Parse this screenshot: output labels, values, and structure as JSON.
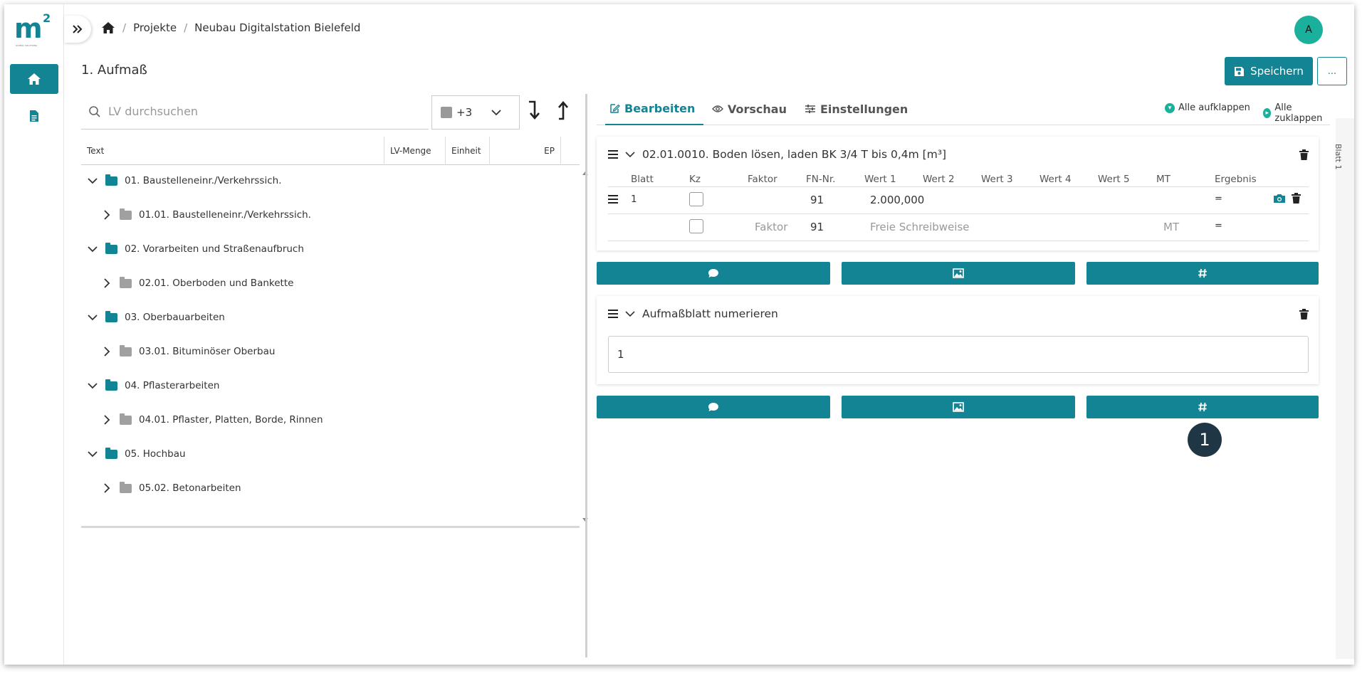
{
  "app": {
    "logo_text": "m",
    "logo_sup": "2",
    "logo_tagline": "GLOBAL SOLUTIONS"
  },
  "sidebar": {
    "items": [
      {
        "icon": "home-icon",
        "active": true
      },
      {
        "icon": "document-icon",
        "active": false
      }
    ]
  },
  "breadcrumb": {
    "home_icon": "home-icon",
    "items": [
      "Projekte",
      "Neubau Digitalstation Bielefeld"
    ],
    "separator": "/"
  },
  "user": {
    "avatar_initial": "A"
  },
  "page": {
    "title": "1. Aufmaß"
  },
  "toolbar": {
    "save_label": "Speichern",
    "more_label": "..."
  },
  "lv_panel": {
    "search_placeholder": "LV durchsuchen",
    "filter_count": "+3",
    "columns": [
      "Text",
      "LV-Menge",
      "Einheit",
      "EP"
    ],
    "tree": [
      {
        "level": 0,
        "label": "01. Baustelleneinr./Verkehrssich.",
        "expanded": true
      },
      {
        "level": 1,
        "label": "01.01. Baustelleneinr./Verkehrssich.",
        "expanded": false
      },
      {
        "level": 0,
        "label": "02. Vorarbeiten und Straßenaufbruch",
        "expanded": true
      },
      {
        "level": 1,
        "label": "02.01. Oberboden und Bankette",
        "expanded": false
      },
      {
        "level": 0,
        "label": "03. Oberbauarbeiten",
        "expanded": true
      },
      {
        "level": 1,
        "label": "03.01. Bituminöser Oberbau",
        "expanded": false
      },
      {
        "level": 0,
        "label": "04. Pflasterarbeiten",
        "expanded": true
      },
      {
        "level": 1,
        "label": "04.01. Pflaster, Platten, Borde, Rinnen",
        "expanded": false
      },
      {
        "level": 0,
        "label": "05. Hochbau",
        "expanded": true
      },
      {
        "level": 1,
        "label": "05.02. Betonarbeiten",
        "expanded": false
      }
    ]
  },
  "editor": {
    "tabs": [
      {
        "label": "Bearbeiten",
        "icon": "edit-icon",
        "active": true
      },
      {
        "label": "Vorschau",
        "icon": "eye-icon",
        "active": false
      },
      {
        "label": "Einstellungen",
        "icon": "sliders-icon",
        "active": false
      }
    ],
    "expand_all": "Alle aufklappen",
    "collapse_all": "Alle zuklappen",
    "side_label": "Blatt 1",
    "position_card": {
      "title": "02.01.0010. Boden lösen, laden BK 3/4 T bis 0,4m [m³]",
      "columns": [
        "Blatt",
        "Kz",
        "Faktor",
        "FN-Nr.",
        "Wert 1",
        "Wert 2",
        "Wert 3",
        "Wert 4",
        "Wert 5",
        "MT",
        "Ergebnis"
      ],
      "rows": [
        {
          "blatt": "1",
          "faktor": "",
          "fn": "91",
          "wert1": "2.000,000",
          "mt": "",
          "ergebnis": "="
        }
      ],
      "new_row": {
        "faktor_placeholder": "Faktor",
        "fn": "91",
        "wert_placeholder": "Freie Schreibweise",
        "mt_placeholder": "MT",
        "ergebnis": "="
      }
    },
    "numbering_card": {
      "title": "Aufmaßblatt numerieren",
      "value": "1"
    },
    "action_icons": [
      "comment-icon",
      "image-icon",
      "hash-icon"
    ],
    "step_badge": "1"
  },
  "colors": {
    "accent": "#138493",
    "avatar": "#1bb09c",
    "badge": "#1f3745"
  }
}
